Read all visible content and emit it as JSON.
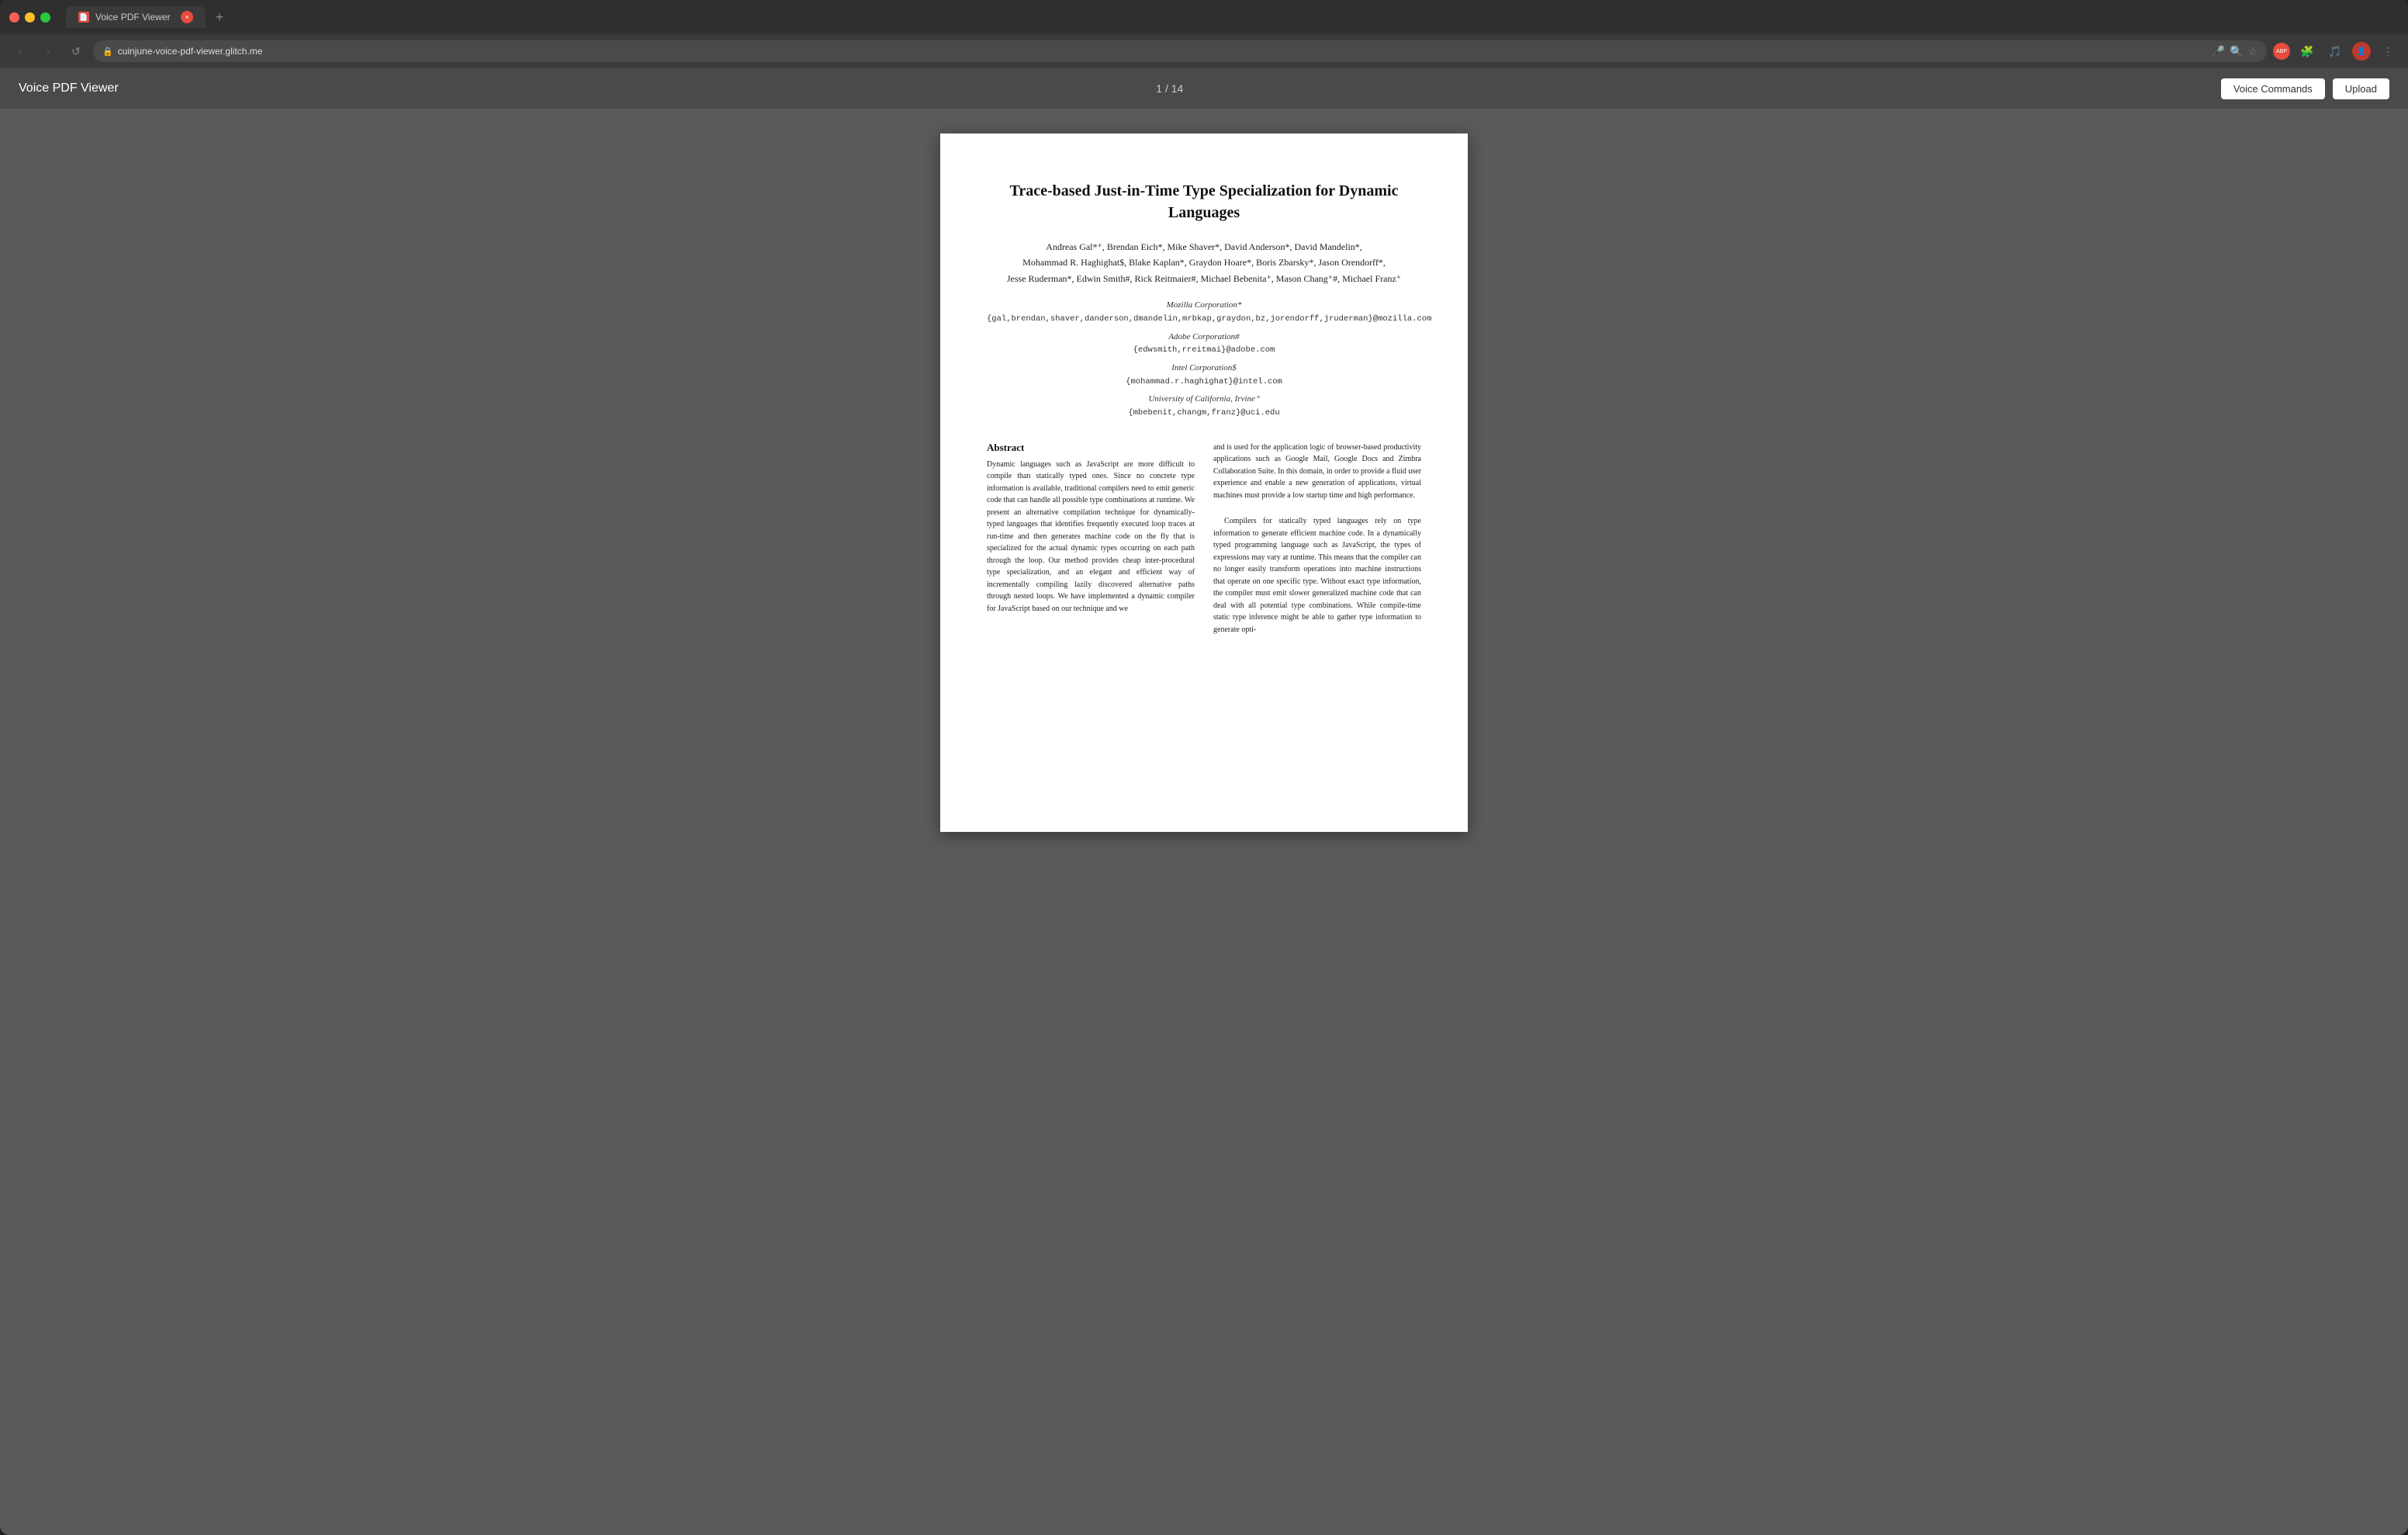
{
  "window": {
    "title": "Voice PDF Viewer"
  },
  "tab": {
    "label": "Voice PDF Viewer",
    "close_label": "×"
  },
  "tab_new_label": "+",
  "navbar": {
    "back_label": "‹",
    "forward_label": "›",
    "refresh_label": "↺",
    "address": "cuinjune-voice-pdf-viewer.glitch.me",
    "mic_label": "🎤",
    "search_label": "🔍",
    "star_label": "☆",
    "ext_label": "ABP",
    "more_label": "⋮"
  },
  "header": {
    "app_title": "Voice PDF Viewer",
    "page_indicator": "1 / 14",
    "voice_commands_label": "Voice Commands",
    "upload_label": "Upload"
  },
  "pdf": {
    "title": "Trace-based Just-in-Time Type Specialization for Dynamic Languages",
    "authors_line1": "Andreas Gal*⁺, Brendan Eich*, Mike Shaver*, David Anderson*, David Mandelin*,",
    "authors_line2": "Mohammad R. Haghighat$, Blake Kaplan*, Graydon Hoare*, Boris Zbarsky*, Jason Orendorff*,",
    "authors_line3": "Jesse Ruderman*, Edwin Smith#, Rick Reitmaier#, Michael Bebenita⁺, Mason Chang⁺#, Michael Franz⁺",
    "mozilla_name": "Mozilla Corporation*",
    "mozilla_email": "{gal,brendan,shaver,danderson,dmandelin,mrbkap,graydon,bz,jorendorff,jruderman}@mozilla.com",
    "adobe_name": "Adobe Corporation#",
    "adobe_email": "{edwsmith,rreitmai}@adobe.com",
    "intel_name": "Intel Corporation$",
    "intel_email": "{mohammad.r.haghighat}@intel.com",
    "uci_name": "University of California, Irvine⁺",
    "uci_email": "{mbebenit,changm,franz}@uci.edu",
    "abstract_title": "Abstract",
    "abstract_text": "Dynamic languages such as JavaScript are more difficult to compile than statically typed ones. Since no concrete type information is available, traditional compilers need to emit generic code that can handle all possible type combinations at runtime. We present an alternative compilation technique for dynamically-typed languages that identifies frequently executed loop traces at run-time and then generates machine code on the fly that is specialized for the actual dynamic types occurring on each path through the loop. Our method provides cheap inter-procedural type specialization, and an elegant and efficient way of incrementally compiling lazily discovered alternative paths through nested loops. We have implemented a dynamic compiler for JavaScript based on our technique and we",
    "right_text_1": "and is used for the application logic of browser-based productivity applications such as Google Mail, Google Docs and Zimbra Collaboration Suite. In this domain, in order to provide a fluid user experience and enable a new generation of applications, virtual machines must provide a low startup time and high performance.",
    "right_text_2": "Compilers for statically typed languages rely on type information to generate efficient machine code. In a dynamically typed programming language such as JavaScript, the types of expressions may vary at runtime. This means that the compiler can no longer easily transform operations into machine instructions that operate on one specific type. Without exact type information, the compiler must emit slower generalized machine code that can deal with all potential type combinations. While compile-time static type inference might be able to gather type information to generate opti-"
  }
}
